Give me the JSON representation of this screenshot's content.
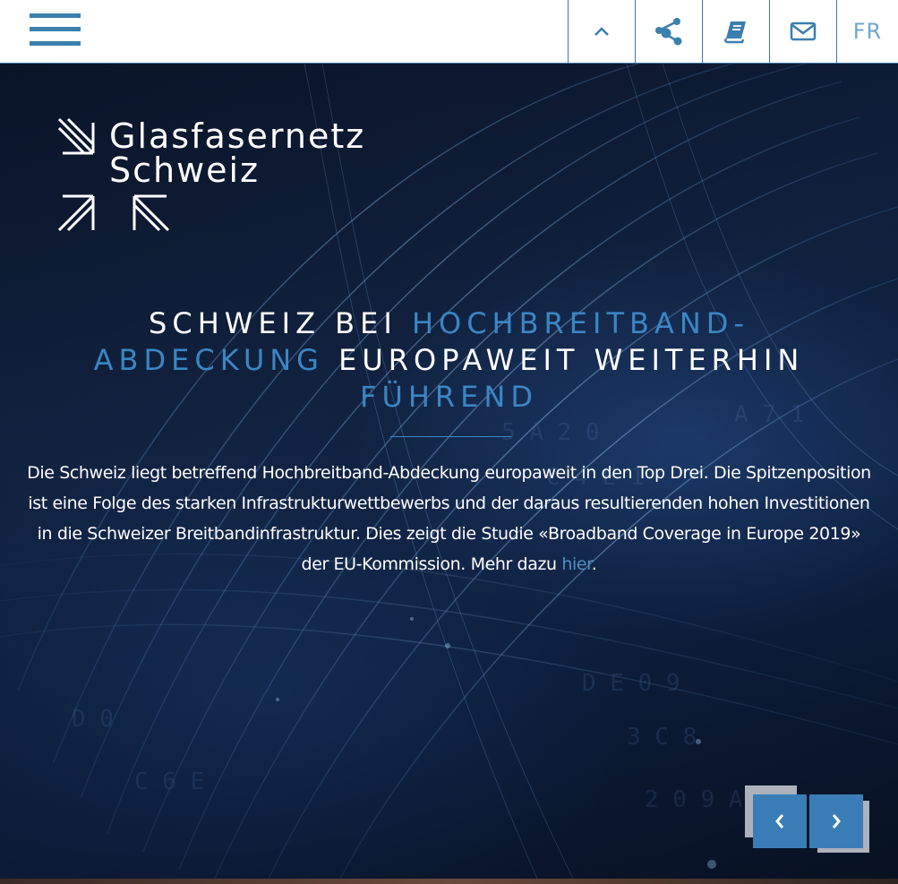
{
  "topbar": {
    "menu_icon": "hamburger-menu-icon",
    "buttons": [
      {
        "name": "scroll-up",
        "icon": "chevron-up-icon"
      },
      {
        "name": "share",
        "icon": "share-icon"
      },
      {
        "name": "publications",
        "icon": "book-icon"
      },
      {
        "name": "contact",
        "icon": "envelope-icon"
      }
    ],
    "language_label": "FR"
  },
  "logo": {
    "line1": "Glasfasernetz",
    "line2": "Schweiz"
  },
  "hero": {
    "headline_part1": "SCHWEIZ BEI ",
    "headline_accent1": "HOCHBREITBAND-ABDECKUNG",
    "headline_part2": " EUROPAWEIT WEITERHIN ",
    "headline_accent2": "FÜHREND",
    "body": "Die Schweiz liegt betreffend Hochbreitband-Abdeckung europaweit in den Top Drei. Die Spitzenposition ist eine Folge des starken Infrastrukturwettbewerbs und der daraus resultierenden hohen Investitionen in die Schweizer Breitbandinfrastruktur. Dies zeigt die Studie «Broadband Coverage in Europe 2019» der EU-Kommission. Mehr dazu ",
    "link_label": "hier",
    "body_end": "."
  },
  "slider": {
    "prev_icon": "chevron-left-icon",
    "next_icon": "chevron-right-icon"
  },
  "colors": {
    "accent": "#3b86c4",
    "topbar_bg": "#ffffff",
    "arrow_bg": "#3a7db6"
  }
}
